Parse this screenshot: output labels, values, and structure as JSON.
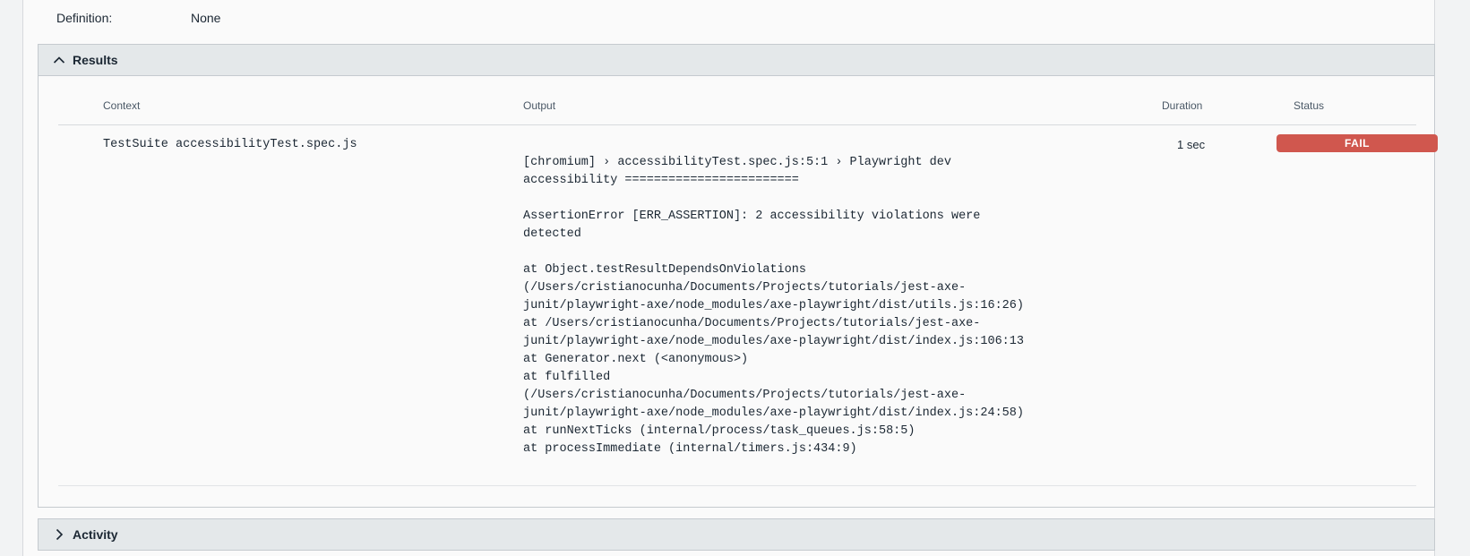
{
  "definition": {
    "label": "Definition:",
    "value": "None"
  },
  "results": {
    "title": "Results",
    "columns": {
      "context": "Context",
      "output": "Output",
      "duration": "Duration",
      "status": "Status"
    },
    "rows": [
      {
        "context": "TestSuite accessibilityTest.spec.js",
        "output": "[chromium] › accessibilityTest.spec.js:5:1 › Playwright dev\naccessibility ========================\n\nAssertionError [ERR_ASSERTION]: 2 accessibility violations were\ndetected\n\nat Object.testResultDependsOnViolations\n(/Users/cristianocunha/Documents/Projects/tutorials/jest-axe-\njunit/playwright-axe/node_modules/axe-playwright/dist/utils.js:16:26)\nat /Users/cristianocunha/Documents/Projects/tutorials/jest-axe-\njunit/playwright-axe/node_modules/axe-playwright/dist/index.js:106:13\nat Generator.next (<anonymous>)\nat fulfilled\n(/Users/cristianocunha/Documents/Projects/tutorials/jest-axe-\njunit/playwright-axe/node_modules/axe-playwright/dist/index.js:24:58)\nat runNextTicks (internal/process/task_queues.js:58:5)\nat processImmediate (internal/timers.js:434:9)",
        "duration": "1 sec",
        "status": "FAIL"
      }
    ]
  },
  "activity": {
    "title": "Activity"
  },
  "colors": {
    "fail": "#d0574e",
    "header_bg": "#e4e8ea"
  },
  "icons": {
    "results_toggle": "chevron-up-icon",
    "activity_toggle": "chevron-right-icon"
  }
}
